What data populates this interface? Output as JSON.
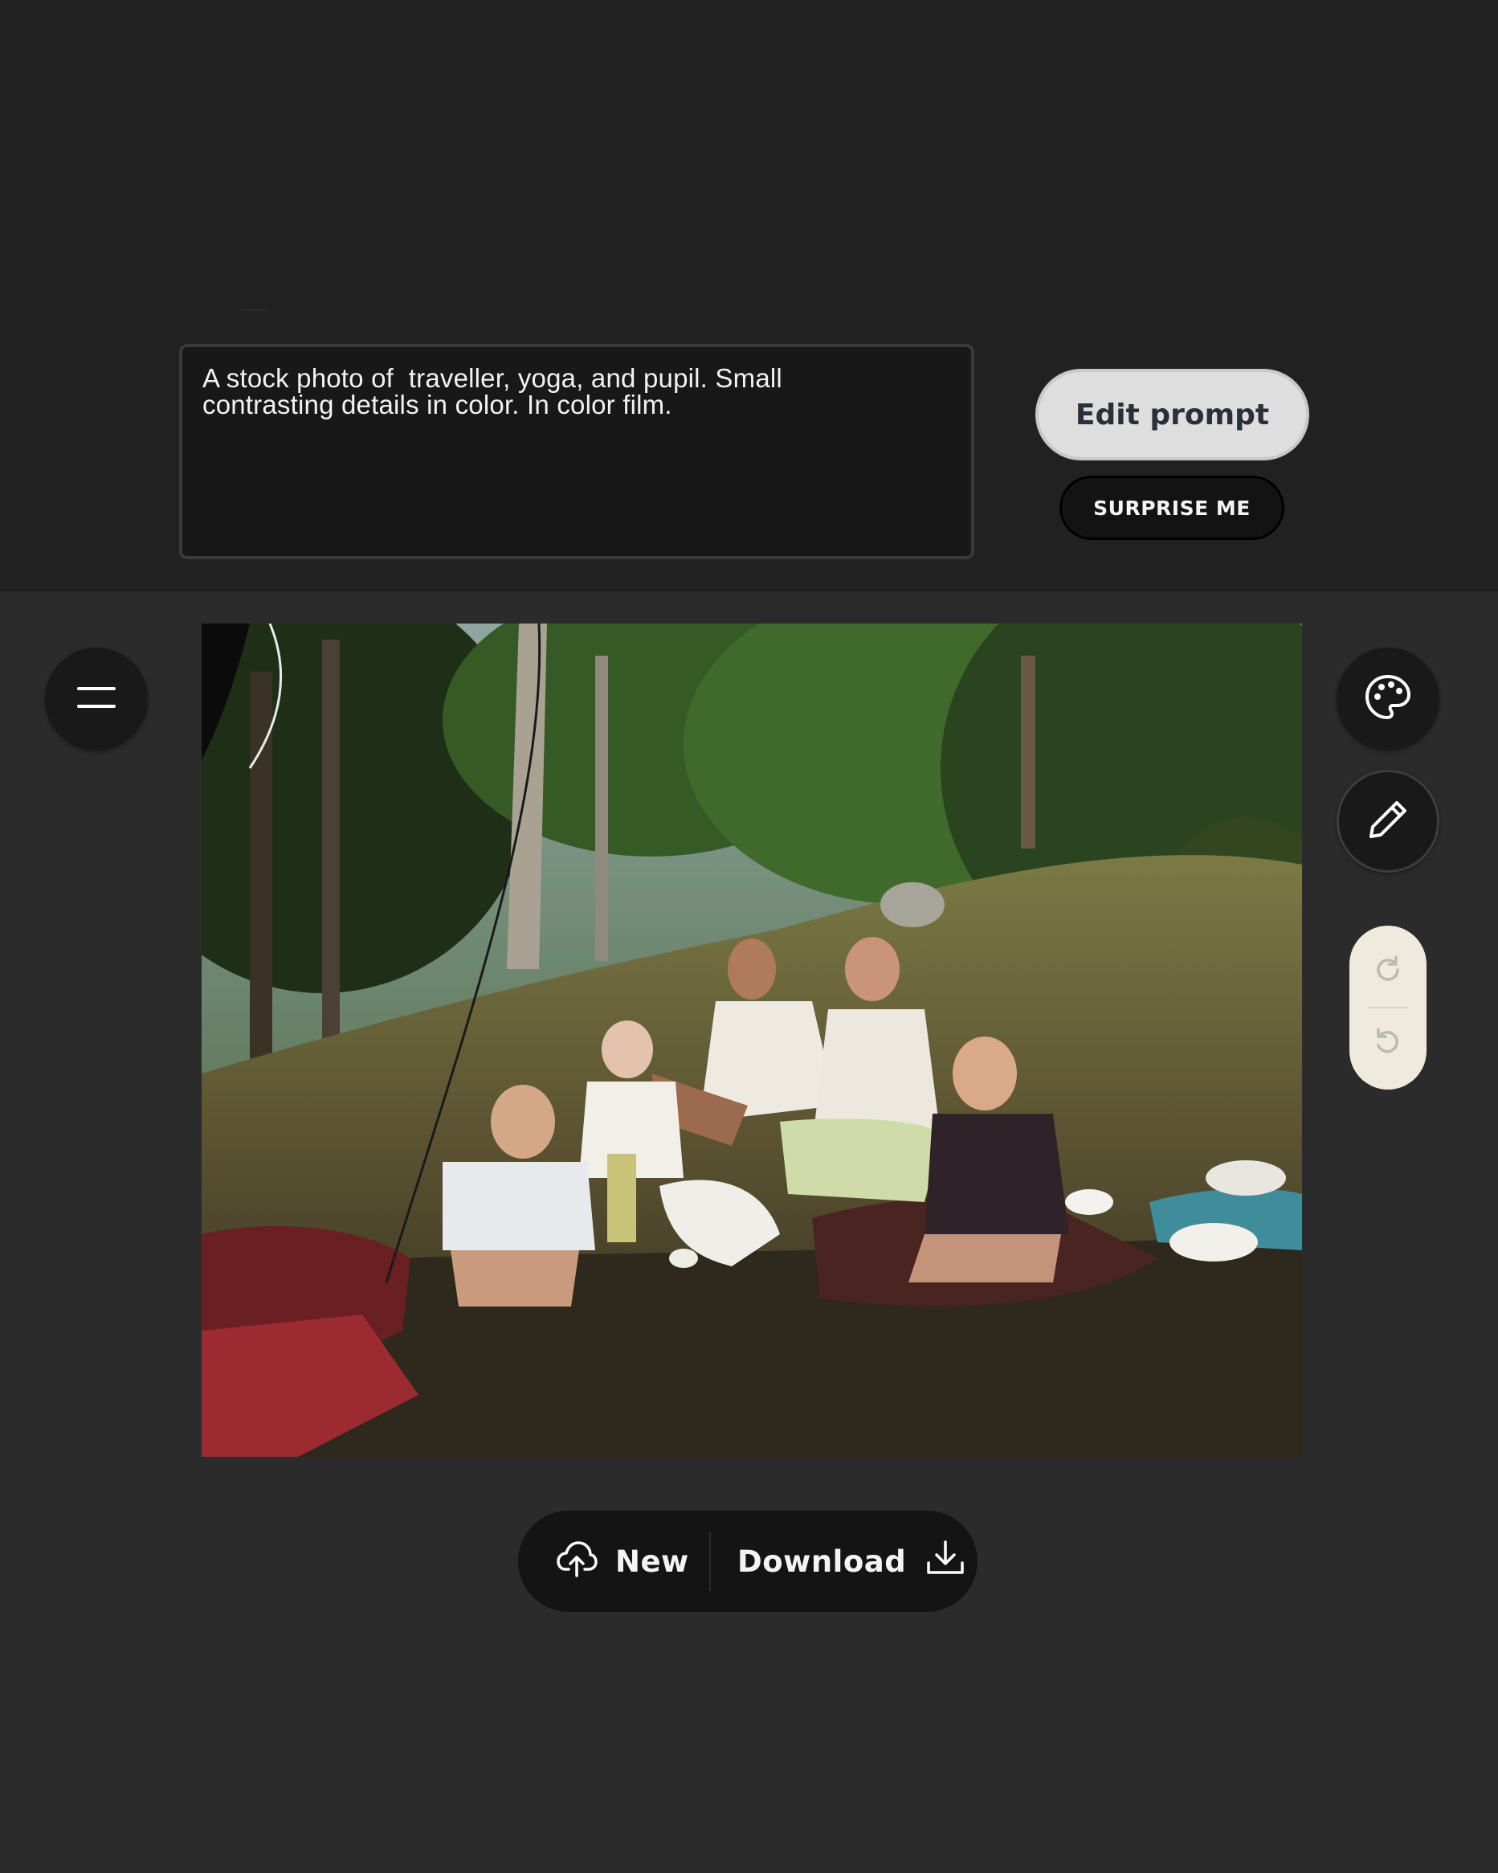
{
  "prompt": {
    "text": "A stock photo of  traveller, yoga, and pupil. Small\ncontrasting details in color. In color film."
  },
  "buttons": {
    "edit_prompt": "Edit prompt",
    "surprise_me": "SURPRISE ME",
    "new": "New",
    "download": "Download"
  },
  "icons": {
    "menu": "menu-icon",
    "palette": "palette-icon",
    "pencil": "pencil-icon",
    "redo": "redo-icon",
    "undo": "undo-icon",
    "upload": "cloud-upload-icon",
    "download": "download-icon"
  },
  "colors": {
    "top_background": "#212122",
    "main_background": "#2b2b2c",
    "edit_prompt_bg": "#dedede",
    "history_pill_bg": "#efeadd"
  }
}
